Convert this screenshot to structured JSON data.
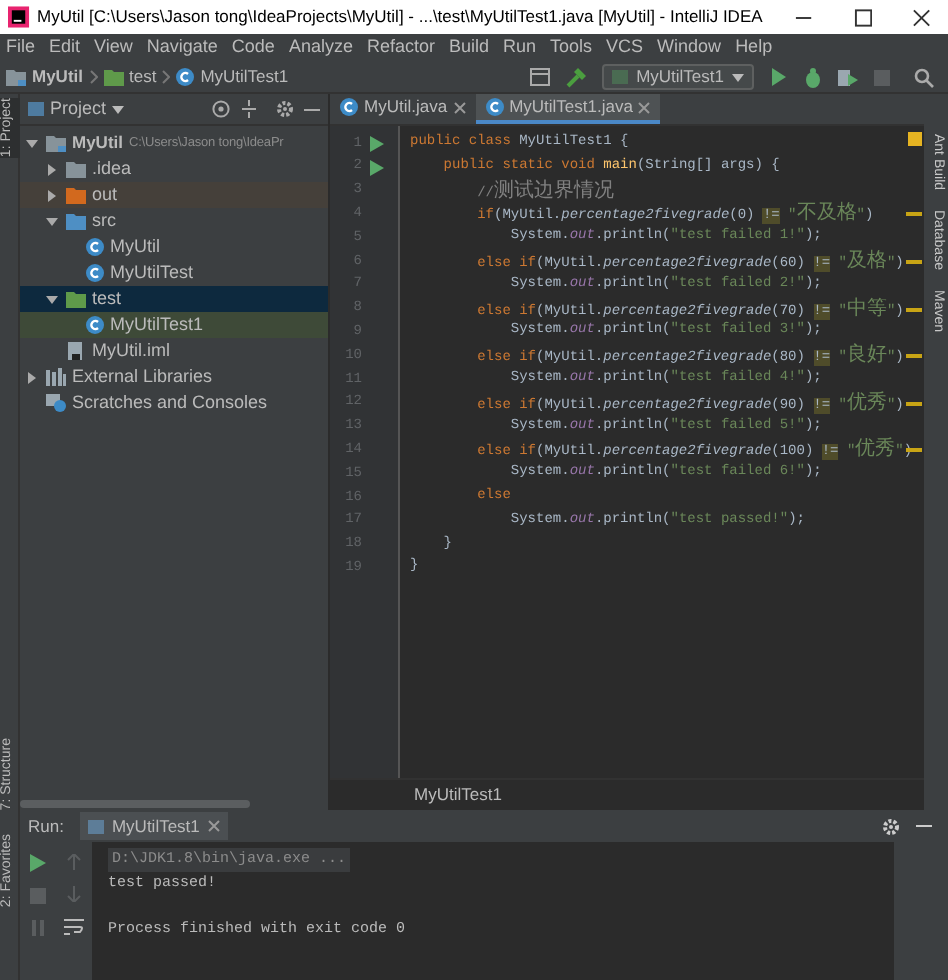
{
  "window": {
    "title": "MyUtil [C:\\Users\\Jason tong\\IdeaProjects\\MyUtil] - ...\\test\\MyUtilTest1.java [MyUtil] - IntelliJ IDEA"
  },
  "menu": [
    "File",
    "Edit",
    "View",
    "Navigate",
    "Code",
    "Analyze",
    "Refactor",
    "Build",
    "Run",
    "Tools",
    "VCS",
    "Window",
    "Help"
  ],
  "breadcrumb": [
    {
      "label": "MyUtil",
      "kind": "project"
    },
    {
      "label": "test",
      "kind": "folder-test"
    },
    {
      "label": "MyUtilTest1",
      "kind": "class"
    }
  ],
  "run_config": {
    "label": "MyUtilTest1"
  },
  "left_strip": [
    {
      "label": "1: Project",
      "selected": true
    },
    {
      "label": "7: Structure",
      "selected": false
    },
    {
      "label": "2: Favorites",
      "selected": false
    }
  ],
  "right_strip": [
    "Ant Build",
    "Database",
    "Maven"
  ],
  "project_panel": {
    "title": "Project",
    "tree": [
      {
        "label": "MyUtil",
        "path": "C:\\Users\\Jason tong\\IdeaPr",
        "kind": "project",
        "expanded": true,
        "selected": false,
        "children": [
          {
            "label": ".idea",
            "kind": "folder",
            "expanded": false,
            "selected": false
          },
          {
            "label": "out",
            "kind": "folder-excluded",
            "expanded": false,
            "selected": false
          },
          {
            "label": "src",
            "kind": "folder-source",
            "expanded": true,
            "selected": false,
            "children": [
              {
                "label": "MyUtil",
                "kind": "class",
                "selected": false
              },
              {
                "label": "MyUtilTest",
                "kind": "class",
                "selected": false
              }
            ]
          },
          {
            "label": "test",
            "kind": "folder-test",
            "expanded": true,
            "selected": true,
            "children": [
              {
                "label": "MyUtilTest1",
                "kind": "test-class",
                "selected": false
              }
            ]
          },
          {
            "label": "MyUtil.iml",
            "kind": "iml",
            "selected": false
          }
        ]
      },
      {
        "label": "External Libraries",
        "kind": "libraries",
        "expanded": false,
        "selected": false
      },
      {
        "label": "Scratches and Consoles",
        "kind": "scratches",
        "selected": false
      }
    ]
  },
  "editor_tabs": [
    {
      "label": "MyUtil.java",
      "selected": false
    },
    {
      "label": "MyUtilTest1.java",
      "selected": true
    }
  ],
  "code_lines": [
    {
      "number": "1",
      "run_marker": true,
      "tokens": [
        {
          "kind": "keyword",
          "text": "public class "
        },
        {
          "kind": "plain",
          "text": "MyUtilTest1 {"
        }
      ]
    },
    {
      "number": "2",
      "run_marker": true,
      "tokens": [
        {
          "kind": "keyword",
          "text": "    public static void "
        },
        {
          "kind": "decl",
          "text": "main"
        },
        {
          "kind": "plain",
          "text": "(String[] args) {"
        }
      ]
    },
    {
      "number": "3",
      "run_marker": false,
      "tokens": [
        {
          "kind": "comment",
          "text": "        //测试边界情况"
        }
      ]
    },
    {
      "number": "4",
      "run_marker": false,
      "tokens": [
        {
          "kind": "keyword",
          "text": "        if"
        },
        {
          "kind": "plain",
          "text": "(MyUtil."
        },
        {
          "kind": "method",
          "text": "percentage2fivegrade"
        },
        {
          "kind": "plain",
          "text": "(0) "
        },
        {
          "kind": "warning",
          "text": "!="
        },
        {
          "kind": "string",
          "text": " \"不及格\""
        },
        {
          "kind": "plain",
          "text": ")"
        }
      ]
    },
    {
      "number": "5",
      "run_marker": false,
      "tokens": [
        {
          "kind": "plain",
          "text": "            System."
        },
        {
          "kind": "field",
          "text": "out"
        },
        {
          "kind": "plain",
          "text": ".println("
        },
        {
          "kind": "string",
          "text": "\"test failed 1!\""
        },
        {
          "kind": "plain",
          "text": ");"
        }
      ]
    },
    {
      "number": "6",
      "run_marker": false,
      "tokens": [
        {
          "kind": "keyword",
          "text": "        else if"
        },
        {
          "kind": "plain",
          "text": "(MyUtil."
        },
        {
          "kind": "method",
          "text": "percentage2fivegrade"
        },
        {
          "kind": "plain",
          "text": "(60) "
        },
        {
          "kind": "warning",
          "text": "!="
        },
        {
          "kind": "string",
          "text": " \"及格\""
        },
        {
          "kind": "plain",
          "text": ")"
        }
      ]
    },
    {
      "number": "7",
      "run_marker": false,
      "tokens": [
        {
          "kind": "plain",
          "text": "            System."
        },
        {
          "kind": "field",
          "text": "out"
        },
        {
          "kind": "plain",
          "text": ".println("
        },
        {
          "kind": "string",
          "text": "\"test failed 2!\""
        },
        {
          "kind": "plain",
          "text": ");"
        }
      ]
    },
    {
      "number": "8",
      "run_marker": false,
      "tokens": [
        {
          "kind": "keyword",
          "text": "        else if"
        },
        {
          "kind": "plain",
          "text": "(MyUtil."
        },
        {
          "kind": "method",
          "text": "percentage2fivegrade"
        },
        {
          "kind": "plain",
          "text": "(70) "
        },
        {
          "kind": "warning",
          "text": "!="
        },
        {
          "kind": "string",
          "text": " \"中等\""
        },
        {
          "kind": "plain",
          "text": ")"
        }
      ]
    },
    {
      "number": "9",
      "run_marker": false,
      "tokens": [
        {
          "kind": "plain",
          "text": "            System."
        },
        {
          "kind": "field",
          "text": "out"
        },
        {
          "kind": "plain",
          "text": ".println("
        },
        {
          "kind": "string",
          "text": "\"test failed 3!\""
        },
        {
          "kind": "plain",
          "text": ");"
        }
      ]
    },
    {
      "number": "10",
      "run_marker": false,
      "tokens": [
        {
          "kind": "keyword",
          "text": "        else if"
        },
        {
          "kind": "plain",
          "text": "(MyUtil."
        },
        {
          "kind": "method",
          "text": "percentage2fivegrade"
        },
        {
          "kind": "plain",
          "text": "(80) "
        },
        {
          "kind": "warning",
          "text": "!="
        },
        {
          "kind": "string",
          "text": " \"良好\""
        },
        {
          "kind": "plain",
          "text": ")"
        }
      ]
    },
    {
      "number": "11",
      "run_marker": false,
      "tokens": [
        {
          "kind": "plain",
          "text": "            System."
        },
        {
          "kind": "field",
          "text": "out"
        },
        {
          "kind": "plain",
          "text": ".println("
        },
        {
          "kind": "string",
          "text": "\"test failed 4!\""
        },
        {
          "kind": "plain",
          "text": ");"
        }
      ]
    },
    {
      "number": "12",
      "run_marker": false,
      "tokens": [
        {
          "kind": "keyword",
          "text": "        else if"
        },
        {
          "kind": "plain",
          "text": "(MyUtil."
        },
        {
          "kind": "method",
          "text": "percentage2fivegrade"
        },
        {
          "kind": "plain",
          "text": "(90) "
        },
        {
          "kind": "warning",
          "text": "!="
        },
        {
          "kind": "string",
          "text": " \"优秀\""
        },
        {
          "kind": "plain",
          "text": ")"
        }
      ]
    },
    {
      "number": "13",
      "run_marker": false,
      "tokens": [
        {
          "kind": "plain",
          "text": "            System."
        },
        {
          "kind": "field",
          "text": "out"
        },
        {
          "kind": "plain",
          "text": ".println("
        },
        {
          "kind": "string",
          "text": "\"test failed 5!\""
        },
        {
          "kind": "plain",
          "text": ");"
        }
      ]
    },
    {
      "number": "14",
      "run_marker": false,
      "tokens": [
        {
          "kind": "keyword",
          "text": "        else if"
        },
        {
          "kind": "plain",
          "text": "(MyUtil."
        },
        {
          "kind": "method",
          "text": "percentage2fivegrade"
        },
        {
          "kind": "plain",
          "text": "(100) "
        },
        {
          "kind": "warning",
          "text": "!="
        },
        {
          "kind": "string",
          "text": " \"优秀\""
        },
        {
          "kind": "plain",
          "text": ")"
        }
      ]
    },
    {
      "number": "15",
      "run_marker": false,
      "tokens": [
        {
          "kind": "plain",
          "text": "            System."
        },
        {
          "kind": "field",
          "text": "out"
        },
        {
          "kind": "plain",
          "text": ".println("
        },
        {
          "kind": "string",
          "text": "\"test failed 6!\""
        },
        {
          "kind": "plain",
          "text": ");"
        }
      ]
    },
    {
      "number": "16",
      "run_marker": false,
      "tokens": [
        {
          "kind": "keyword",
          "text": "        else"
        }
      ]
    },
    {
      "number": "17",
      "run_marker": false,
      "tokens": [
        {
          "kind": "plain",
          "text": "            System."
        },
        {
          "kind": "field",
          "text": "out"
        },
        {
          "kind": "plain",
          "text": ".println("
        },
        {
          "kind": "string",
          "text": "\"test passed!\""
        },
        {
          "kind": "plain",
          "text": ");"
        }
      ]
    },
    {
      "number": "18",
      "run_marker": false,
      "tokens": [
        {
          "kind": "plain",
          "text": "    }"
        }
      ]
    },
    {
      "number": "19",
      "run_marker": false,
      "tokens": [
        {
          "kind": "plain",
          "text": "}"
        }
      ]
    }
  ],
  "editor_breadcrumb": "MyUtilTest1",
  "run_panel": {
    "label": "Run:",
    "tab": "MyUtilTest1",
    "console": [
      {
        "kind": "command",
        "text": "D:\\JDK1.8\\bin\\java.exe ..."
      },
      {
        "kind": "output",
        "text": "test passed!"
      },
      {
        "kind": "exit",
        "text": "Process finished with exit code 0"
      }
    ]
  }
}
